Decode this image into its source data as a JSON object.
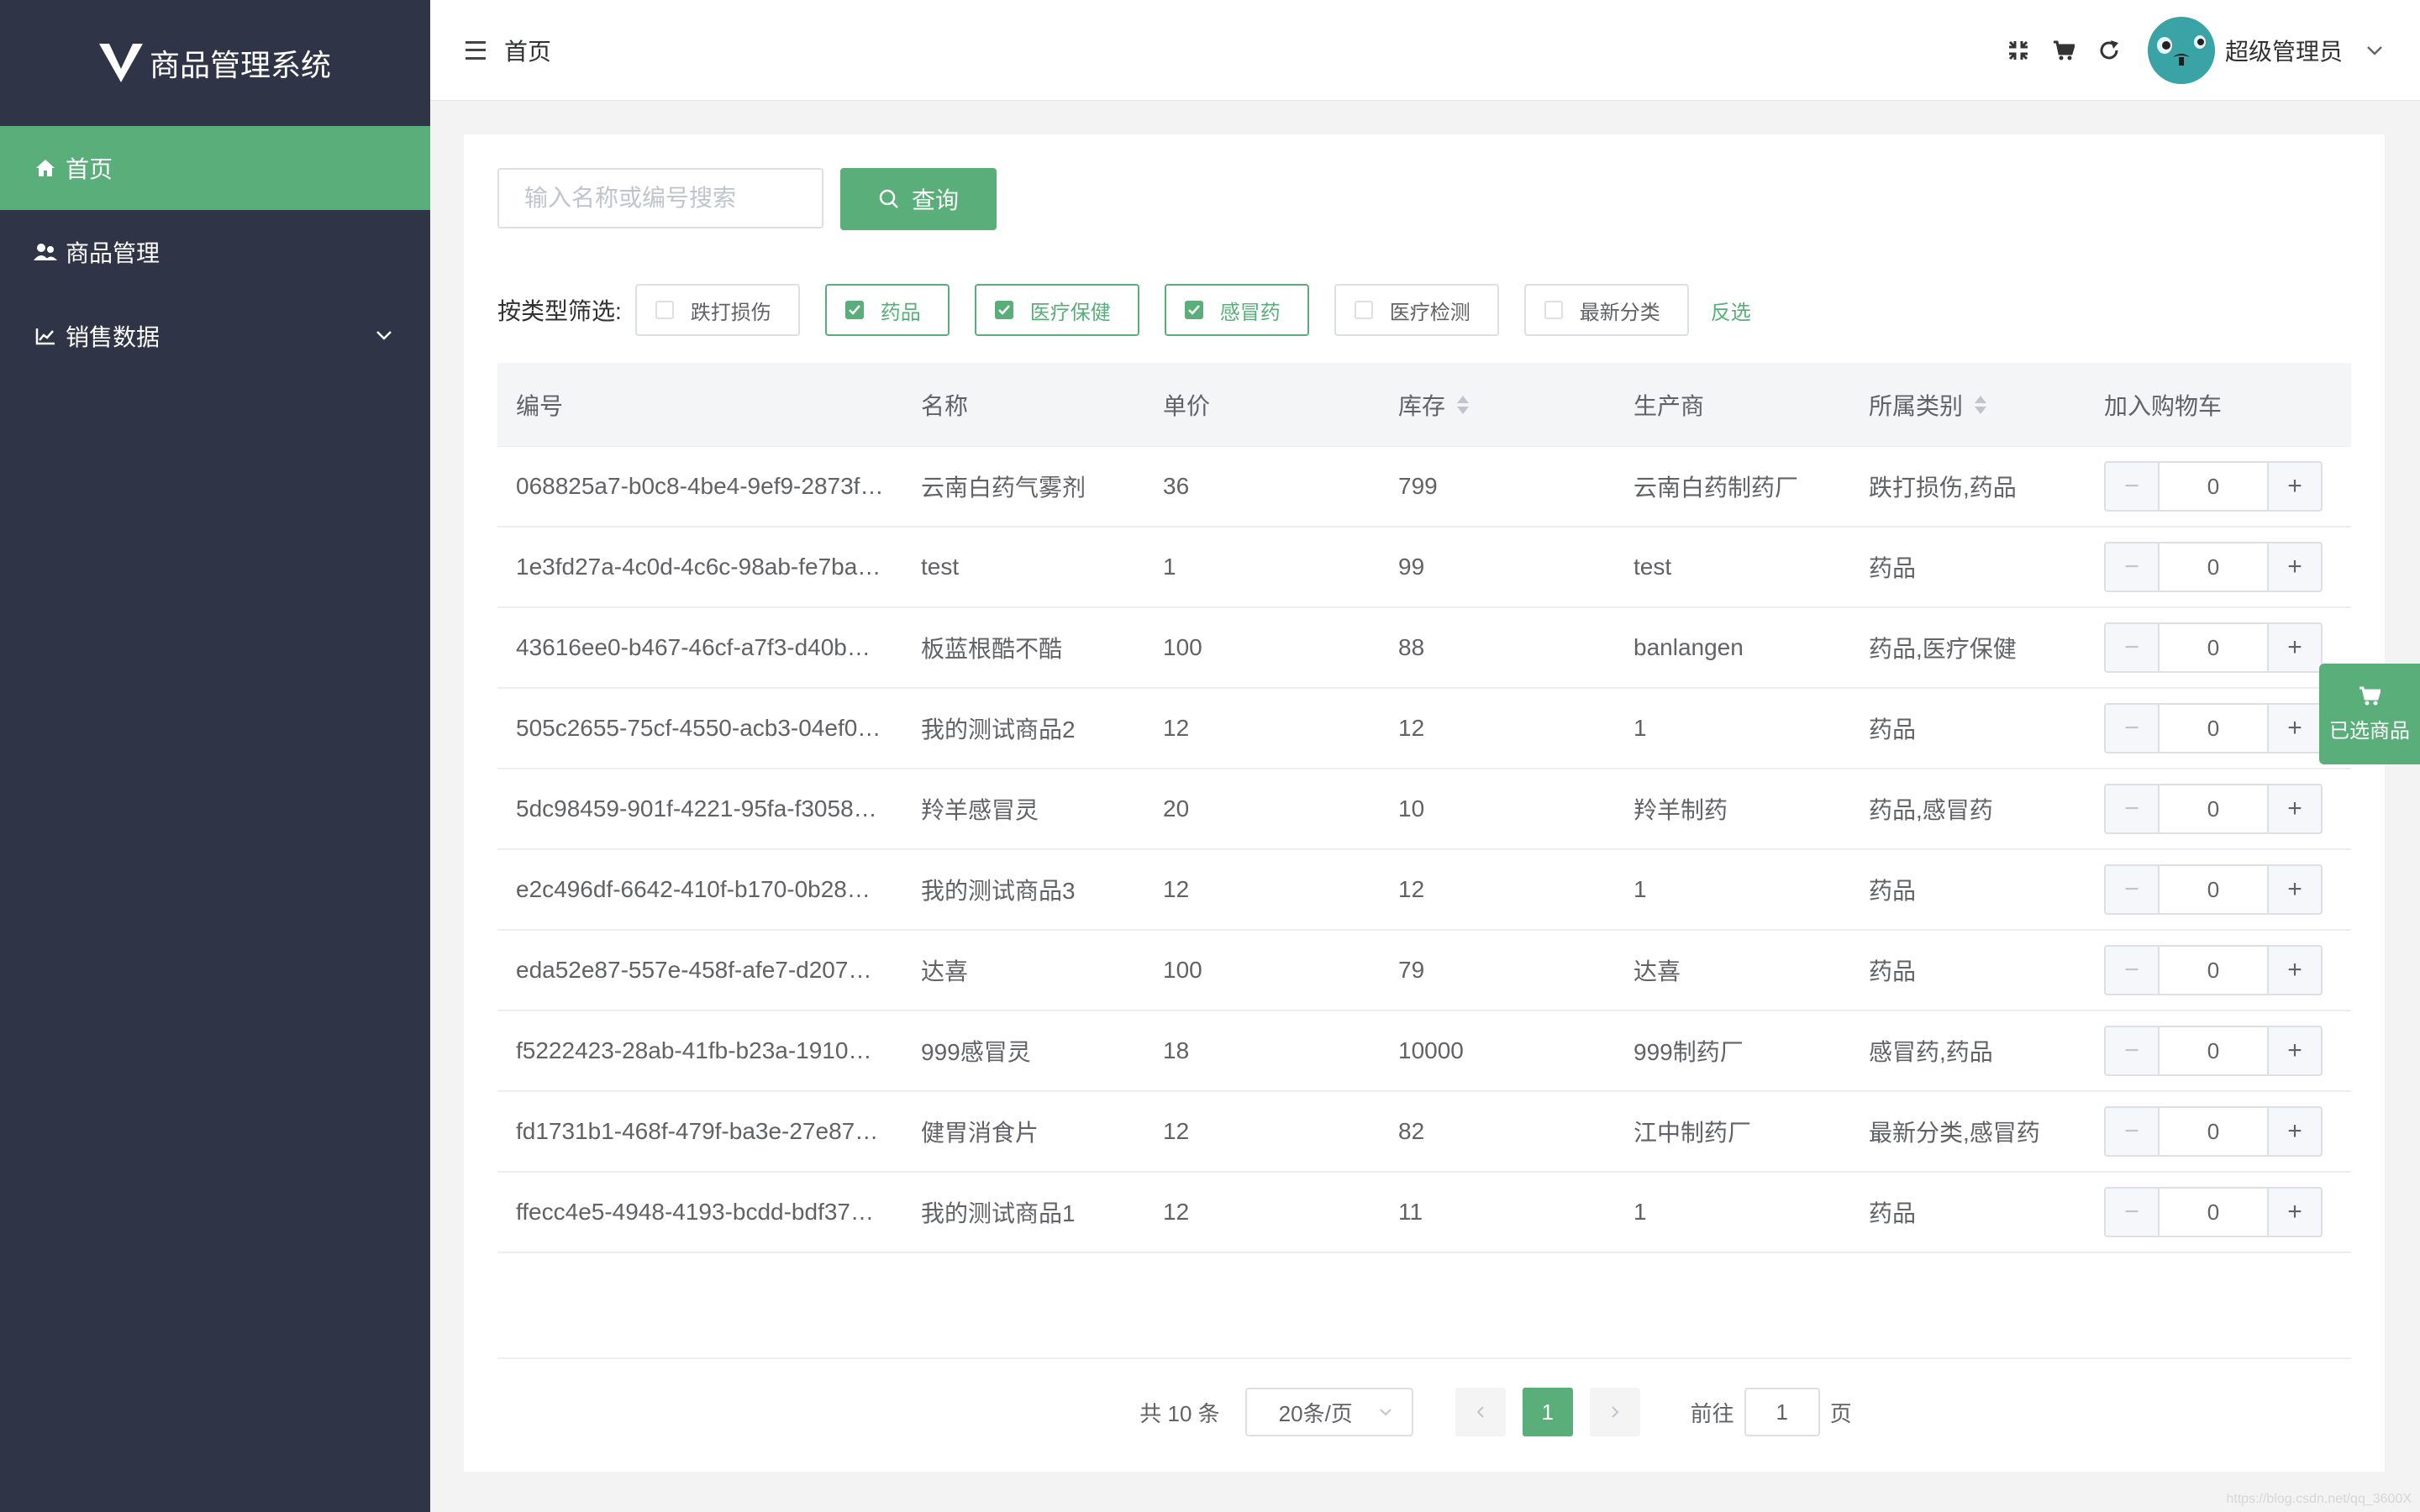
{
  "app": {
    "title": "商品管理系统"
  },
  "sidebar": {
    "items": [
      {
        "label": "首页",
        "icon": "home-icon"
      },
      {
        "label": "商品管理",
        "icon": "users-icon"
      },
      {
        "label": "销售数据",
        "icon": "chart-icon"
      }
    ]
  },
  "header": {
    "breadcrumb": "首页",
    "username": "超级管理员"
  },
  "search": {
    "placeholder": "输入名称或编号搜索",
    "button_label": "查询"
  },
  "filter": {
    "label": "按类型筛选:",
    "options": [
      {
        "label": "跌打损伤",
        "checked": false
      },
      {
        "label": "药品",
        "checked": true
      },
      {
        "label": "医疗保健",
        "checked": true
      },
      {
        "label": "感冒药",
        "checked": true
      },
      {
        "label": "医疗检测",
        "checked": false
      },
      {
        "label": "最新分类",
        "checked": false
      }
    ],
    "invert_label": "反选"
  },
  "table": {
    "columns": [
      "编号",
      "名称",
      "单价",
      "库存",
      "生产商",
      "所属类别",
      "加入购物车"
    ],
    "rows": [
      [
        "068825a7-b0c8-4be4-9ef9-2873f…",
        "云南白药气雾剂",
        "36",
        "799",
        "云南白药制药厂",
        "跌打损伤,药品",
        "0"
      ],
      [
        "1e3fd27a-4c0d-4c6c-98ab-fe7ba…",
        "test",
        "1",
        "99",
        "test",
        "药品",
        "0"
      ],
      [
        "43616ee0-b467-46cf-a7f3-d40b…",
        "板蓝根酷不酷",
        "100",
        "88",
        "banlangen",
        "药品,医疗保健",
        "0"
      ],
      [
        "505c2655-75cf-4550-acb3-04ef0…",
        "我的测试商品2",
        "12",
        "12",
        "1",
        "药品",
        "0"
      ],
      [
        "5dc98459-901f-4221-95fa-f3058…",
        "羚羊感冒灵",
        "20",
        "10",
        "羚羊制药",
        "药品,感冒药",
        "0"
      ],
      [
        "e2c496df-6642-410f-b170-0b28…",
        "我的测试商品3",
        "12",
        "12",
        "1",
        "药品",
        "0"
      ],
      [
        "eda52e87-557e-458f-afe7-d207…",
        "达喜",
        "100",
        "79",
        "达喜",
        "药品",
        "0"
      ],
      [
        "f5222423-28ab-41fb-b23a-1910…",
        "999感冒灵",
        "18",
        "10000",
        "999制药厂",
        "感冒药,药品",
        "0"
      ],
      [
        "fd1731b1-468f-479f-ba3e-27e87…",
        "健胃消食片",
        "12",
        "82",
        "江中制药厂",
        "最新分类,感冒药",
        "0"
      ],
      [
        "ffecc4e5-4948-4193-bcdd-bdf37…",
        "我的测试商品1",
        "12",
        "11",
        "1",
        "药品",
        "0"
      ]
    ]
  },
  "pagination": {
    "total": "共 10 条",
    "page_size": "20条/页",
    "current_page": "1",
    "goto_label": "前往",
    "goto_value": "1",
    "goto_suffix": "页"
  },
  "float_cart": {
    "label": "已选商品"
  },
  "watermark": "https://blog.csdn.net/qq_3600X",
  "colors": {
    "sidebar": "#2f3447",
    "accent": "#5aae7a"
  }
}
